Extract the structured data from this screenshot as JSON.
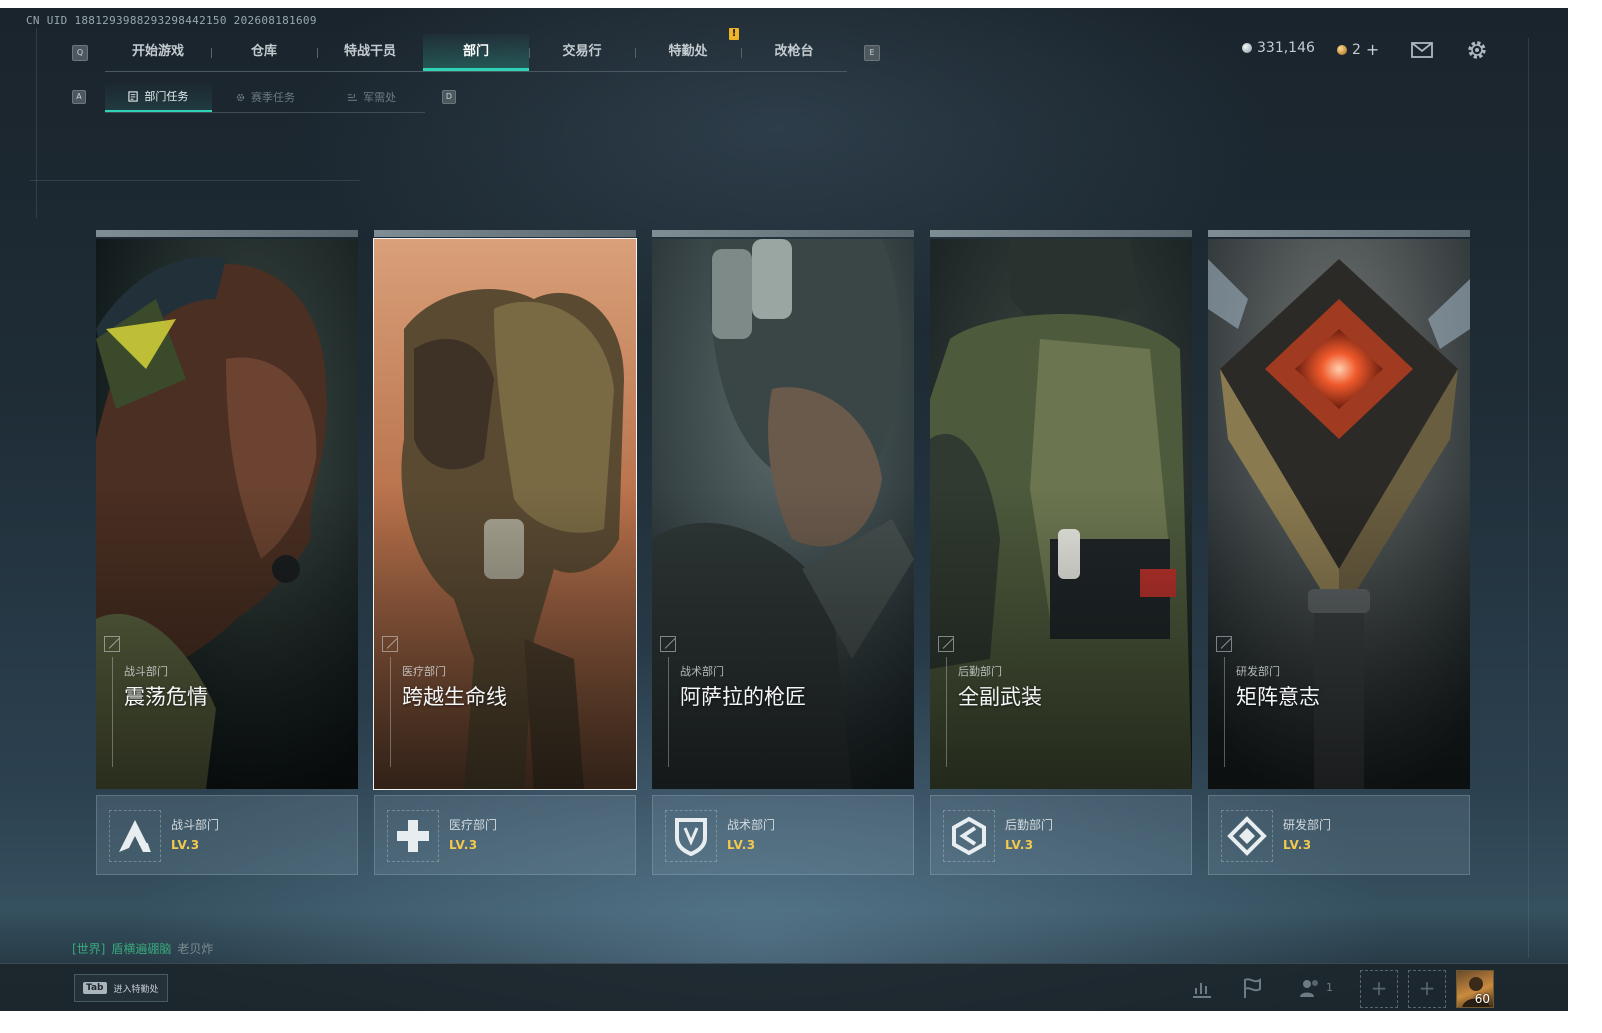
{
  "header": {
    "uid": "CN UID 1881293988293298442150 202608181609",
    "tab_keys": {
      "left": "Q",
      "right": "E"
    },
    "tabs": [
      {
        "label": "开始游戏",
        "active": false
      },
      {
        "label": "仓库",
        "active": false
      },
      {
        "label": "特战干员",
        "active": false
      },
      {
        "label": "部门",
        "active": true
      },
      {
        "label": "交易行",
        "active": false
      },
      {
        "label": "特勤处",
        "active": false
      },
      {
        "label": "改枪台",
        "active": false
      }
    ],
    "alert_badge": "!",
    "currency": {
      "silver": "331,146",
      "gold": "2",
      "plus": "+"
    }
  },
  "subnav": {
    "tab_keys": {
      "left": "A",
      "right": "D"
    },
    "tabs": [
      {
        "label": "部门任务",
        "active": true,
        "icon": "task-icon"
      },
      {
        "label": "赛季任务",
        "active": false,
        "icon": "gear-icon"
      },
      {
        "label": "军需处",
        "active": false,
        "icon": "supply-icon"
      }
    ]
  },
  "departments": [
    {
      "category": "战斗部门",
      "title": "震荡危情",
      "footer_name": "战斗部门",
      "level": "LV.3",
      "icon": "combat-a-icon",
      "selected": false
    },
    {
      "category": "医疗部门",
      "title": "跨越生命线",
      "footer_name": "医疗部门",
      "level": "LV.3",
      "icon": "medical-cross-icon",
      "selected": true
    },
    {
      "category": "战术部门",
      "title": "阿萨拉的枪匠",
      "footer_name": "战术部门",
      "level": "LV.3",
      "icon": "tactical-shield-icon",
      "selected": false
    },
    {
      "category": "后勤部门",
      "title": "全副武装",
      "footer_name": "后勤部门",
      "level": "LV.3",
      "icon": "logistics-hexagon-icon",
      "selected": false
    },
    {
      "category": "研发部门",
      "title": "矩阵意志",
      "footer_name": "研发部门",
      "level": "LV.3",
      "icon": "research-diamond-icon",
      "selected": false
    }
  ],
  "chat": {
    "channel": "[世界]",
    "sender": "盾横遍硼脑",
    "message": "老贝炸"
  },
  "bottom_bar": {
    "tab_key": "Tab",
    "tab_label": "进入特勤处",
    "squad_count": "1",
    "slot_symbol": "+",
    "player_level": "60"
  },
  "colors": {
    "accent": "#2fd3b5",
    "level_gold": "#f2c94c",
    "chat_green": "#38a87a",
    "alert_yellow": "#f0b429"
  }
}
